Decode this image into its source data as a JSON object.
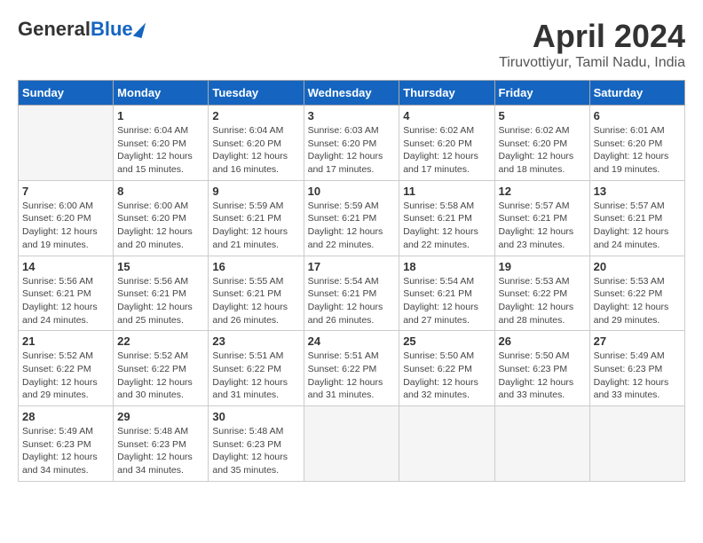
{
  "header": {
    "logo_general": "General",
    "logo_blue": "Blue",
    "title": "April 2024",
    "subtitle": "Tiruvottiyur, Tamil Nadu, India"
  },
  "weekdays": [
    "Sunday",
    "Monday",
    "Tuesday",
    "Wednesday",
    "Thursday",
    "Friday",
    "Saturday"
  ],
  "weeks": [
    [
      {
        "day": "",
        "info": ""
      },
      {
        "day": "1",
        "info": "Sunrise: 6:04 AM\nSunset: 6:20 PM\nDaylight: 12 hours\nand 15 minutes."
      },
      {
        "day": "2",
        "info": "Sunrise: 6:04 AM\nSunset: 6:20 PM\nDaylight: 12 hours\nand 16 minutes."
      },
      {
        "day": "3",
        "info": "Sunrise: 6:03 AM\nSunset: 6:20 PM\nDaylight: 12 hours\nand 17 minutes."
      },
      {
        "day": "4",
        "info": "Sunrise: 6:02 AM\nSunset: 6:20 PM\nDaylight: 12 hours\nand 17 minutes."
      },
      {
        "day": "5",
        "info": "Sunrise: 6:02 AM\nSunset: 6:20 PM\nDaylight: 12 hours\nand 18 minutes."
      },
      {
        "day": "6",
        "info": "Sunrise: 6:01 AM\nSunset: 6:20 PM\nDaylight: 12 hours\nand 19 minutes."
      }
    ],
    [
      {
        "day": "7",
        "info": "Sunrise: 6:00 AM\nSunset: 6:20 PM\nDaylight: 12 hours\nand 19 minutes."
      },
      {
        "day": "8",
        "info": "Sunrise: 6:00 AM\nSunset: 6:20 PM\nDaylight: 12 hours\nand 20 minutes."
      },
      {
        "day": "9",
        "info": "Sunrise: 5:59 AM\nSunset: 6:21 PM\nDaylight: 12 hours\nand 21 minutes."
      },
      {
        "day": "10",
        "info": "Sunrise: 5:59 AM\nSunset: 6:21 PM\nDaylight: 12 hours\nand 22 minutes."
      },
      {
        "day": "11",
        "info": "Sunrise: 5:58 AM\nSunset: 6:21 PM\nDaylight: 12 hours\nand 22 minutes."
      },
      {
        "day": "12",
        "info": "Sunrise: 5:57 AM\nSunset: 6:21 PM\nDaylight: 12 hours\nand 23 minutes."
      },
      {
        "day": "13",
        "info": "Sunrise: 5:57 AM\nSunset: 6:21 PM\nDaylight: 12 hours\nand 24 minutes."
      }
    ],
    [
      {
        "day": "14",
        "info": "Sunrise: 5:56 AM\nSunset: 6:21 PM\nDaylight: 12 hours\nand 24 minutes."
      },
      {
        "day": "15",
        "info": "Sunrise: 5:56 AM\nSunset: 6:21 PM\nDaylight: 12 hours\nand 25 minutes."
      },
      {
        "day": "16",
        "info": "Sunrise: 5:55 AM\nSunset: 6:21 PM\nDaylight: 12 hours\nand 26 minutes."
      },
      {
        "day": "17",
        "info": "Sunrise: 5:54 AM\nSunset: 6:21 PM\nDaylight: 12 hours\nand 26 minutes."
      },
      {
        "day": "18",
        "info": "Sunrise: 5:54 AM\nSunset: 6:21 PM\nDaylight: 12 hours\nand 27 minutes."
      },
      {
        "day": "19",
        "info": "Sunrise: 5:53 AM\nSunset: 6:22 PM\nDaylight: 12 hours\nand 28 minutes."
      },
      {
        "day": "20",
        "info": "Sunrise: 5:53 AM\nSunset: 6:22 PM\nDaylight: 12 hours\nand 29 minutes."
      }
    ],
    [
      {
        "day": "21",
        "info": "Sunrise: 5:52 AM\nSunset: 6:22 PM\nDaylight: 12 hours\nand 29 minutes."
      },
      {
        "day": "22",
        "info": "Sunrise: 5:52 AM\nSunset: 6:22 PM\nDaylight: 12 hours\nand 30 minutes."
      },
      {
        "day": "23",
        "info": "Sunrise: 5:51 AM\nSunset: 6:22 PM\nDaylight: 12 hours\nand 31 minutes."
      },
      {
        "day": "24",
        "info": "Sunrise: 5:51 AM\nSunset: 6:22 PM\nDaylight: 12 hours\nand 31 minutes."
      },
      {
        "day": "25",
        "info": "Sunrise: 5:50 AM\nSunset: 6:22 PM\nDaylight: 12 hours\nand 32 minutes."
      },
      {
        "day": "26",
        "info": "Sunrise: 5:50 AM\nSunset: 6:23 PM\nDaylight: 12 hours\nand 33 minutes."
      },
      {
        "day": "27",
        "info": "Sunrise: 5:49 AM\nSunset: 6:23 PM\nDaylight: 12 hours\nand 33 minutes."
      }
    ],
    [
      {
        "day": "28",
        "info": "Sunrise: 5:49 AM\nSunset: 6:23 PM\nDaylight: 12 hours\nand 34 minutes."
      },
      {
        "day": "29",
        "info": "Sunrise: 5:48 AM\nSunset: 6:23 PM\nDaylight: 12 hours\nand 34 minutes."
      },
      {
        "day": "30",
        "info": "Sunrise: 5:48 AM\nSunset: 6:23 PM\nDaylight: 12 hours\nand 35 minutes."
      },
      {
        "day": "",
        "info": ""
      },
      {
        "day": "",
        "info": ""
      },
      {
        "day": "",
        "info": ""
      },
      {
        "day": "",
        "info": ""
      }
    ]
  ]
}
